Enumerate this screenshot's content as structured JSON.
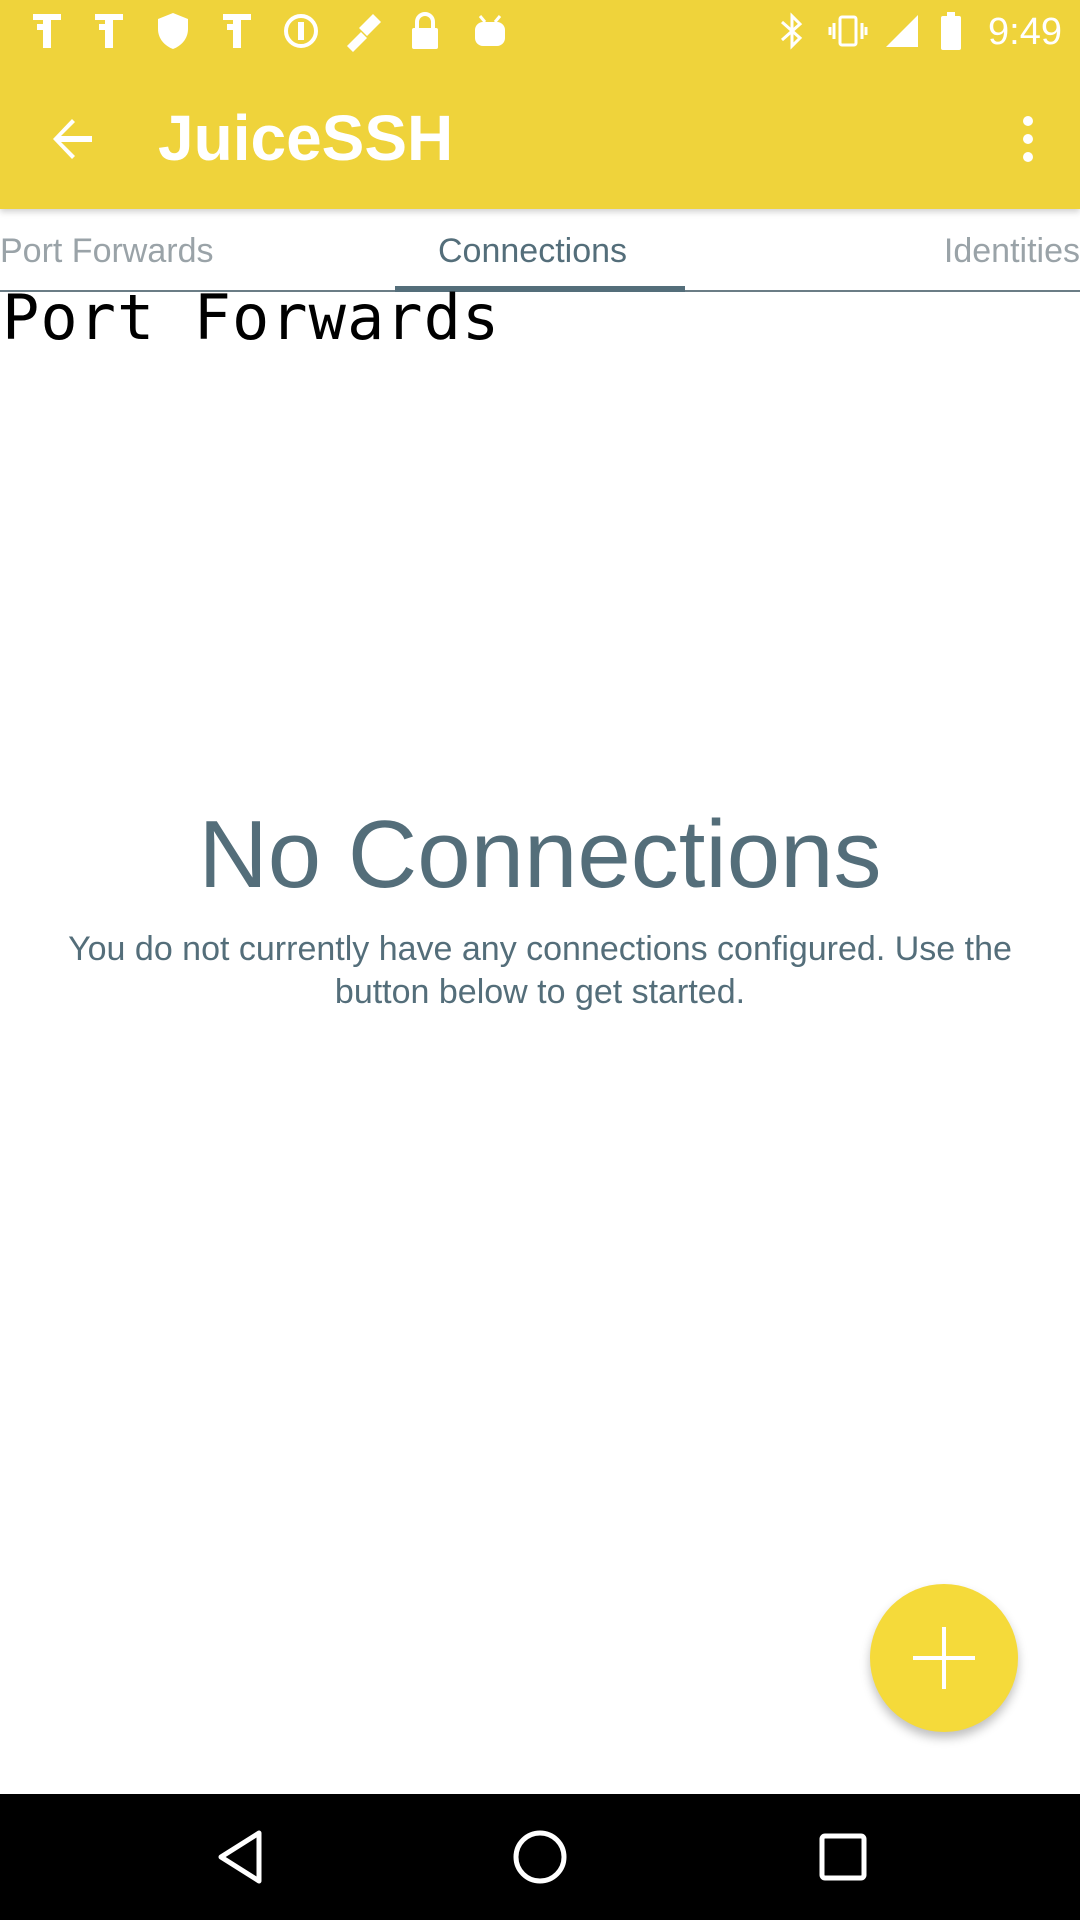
{
  "status_bar": {
    "time": "9:49",
    "left_icons": [
      "notification-app-icon",
      "notification-app-icon",
      "shield-icon",
      "notification-app-icon",
      "alert-circle-icon",
      "fake-gps-icon",
      "lock-icon",
      "android-icon"
    ],
    "right_icons": [
      "bluetooth-icon",
      "vibrate-icon",
      "signal-icon",
      "battery-icon"
    ]
  },
  "app_bar": {
    "title": "JuiceSSH",
    "back_icon": "arrow-back-icon",
    "overflow_icon": "more-vert-icon",
    "color": "#efd33b"
  },
  "tabs": [
    {
      "label": "Port Forwards",
      "selected": false
    },
    {
      "label": "Connections",
      "selected": true
    },
    {
      "label": "Identities",
      "selected": false
    }
  ],
  "overlay_label": "Port Forwards",
  "empty_state": {
    "title": "No Connections",
    "message": "You do not currently have any connections configured. Use the button below to get started."
  },
  "fab": {
    "icon": "plus-icon",
    "color": "#f5da3a"
  },
  "nav_bar": {
    "buttons": [
      "back-triangle-icon",
      "home-circle-icon",
      "recents-square-icon"
    ]
  },
  "colors": {
    "accent_text": "#546e7a",
    "inactive_tab": "#9aa3a8"
  }
}
